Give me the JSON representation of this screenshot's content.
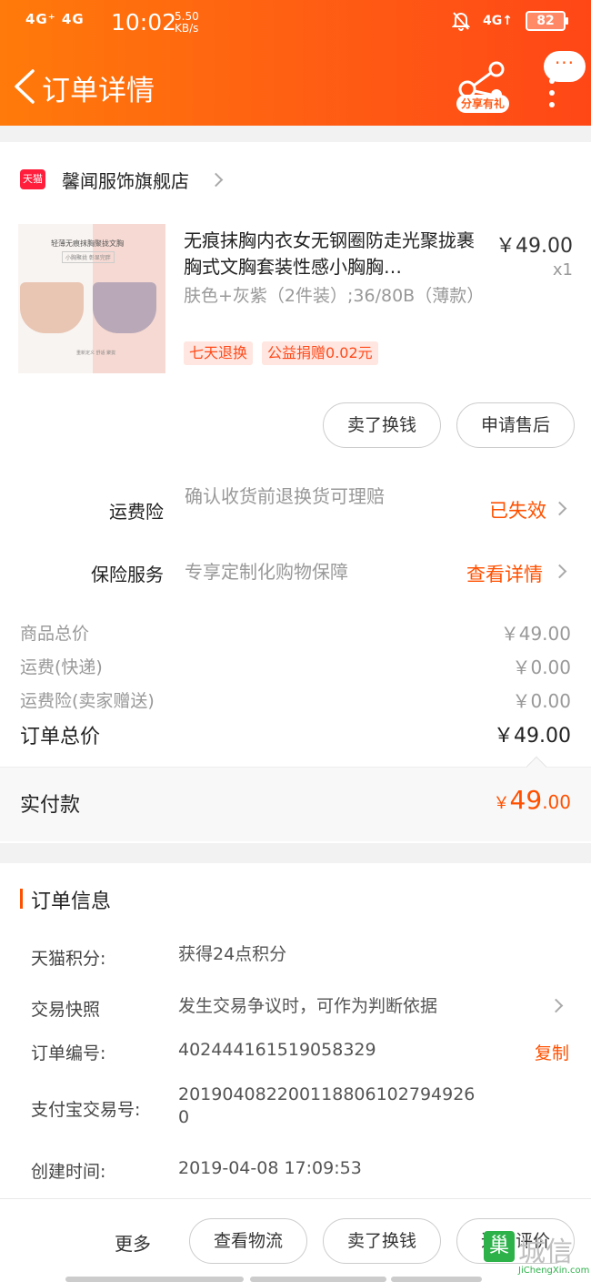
{
  "status_bar": {
    "signal": "4G⁺ 4G",
    "time": "10:02",
    "speed_value": "5.50",
    "speed_unit": "KB/s",
    "net_right": "4G↑",
    "battery": "82"
  },
  "nav": {
    "title": "订单详情",
    "share_tag": "分享有礼",
    "bubble": "···"
  },
  "shop": {
    "badge": "天猫",
    "name": "馨闻服饰旗舰店"
  },
  "product": {
    "title": "无痕抹胸内衣女无钢圈防走光聚拢裹胸式文胸套装性感小胸胸…",
    "price": "￥49.00",
    "qty": "x1",
    "spec": "肤色+灰紫（2件装）;36/80B（薄款）",
    "tags": [
      "七天退换",
      "公益捐赠0.02元"
    ],
    "image_text": {
      "headline": "轻薄无痕抹胸聚拢文胸",
      "sub": "小胸聚拢 彰显完胖",
      "foot": "重新定义 舒适 聚拢"
    }
  },
  "product_actions": {
    "sell": "卖了换钱",
    "after_sale": "申请售后"
  },
  "insurance": {
    "freight_label": "运费险",
    "freight_desc": "确认收货前退换货可理赔",
    "freight_status": "已失效",
    "service_label": "保险服务",
    "service_desc": "专享定制化购物保障",
    "service_link": "查看详情"
  },
  "summary": {
    "items": [
      {
        "label": "商品总价",
        "value": "￥49.00"
      },
      {
        "label": "运费(快递)",
        "value": "￥0.00"
      },
      {
        "label": "运费险(卖家赠送)",
        "value": "￥0.00"
      }
    ],
    "total_label": "订单总价",
    "total_value": "￥49.00",
    "paid_label": "实付款",
    "paid_currency": "￥",
    "paid_int": "49",
    "paid_dec": ".00"
  },
  "order_info": {
    "title": "订单信息",
    "points_label": "天猫积分:",
    "points_value": "获得24点积分",
    "snapshot_label": "交易快照",
    "snapshot_value": "发生交易争议时，可作为判断依据",
    "order_no_label": "订单编号:",
    "order_no_value": "402444161519058329",
    "copy": "复制",
    "alipay_label": "支付宝交易号:",
    "alipay_value_line1": "201904082200118806102794926",
    "alipay_value_line2": "0",
    "created_label": "创建时间:",
    "created_value": "2019-04-08 17:09:53"
  },
  "bottom_bar": {
    "more": "更多",
    "logistics": "查看物流",
    "sell": "卖了换钱",
    "review": "追加评价"
  },
  "watermark": {
    "box": "巢",
    "big": "城信",
    "small": "JiChengXin.com"
  },
  "colors": {
    "brand": "#ff5000",
    "header_start": "#ff7a0a",
    "header_end": "#ff4716"
  }
}
